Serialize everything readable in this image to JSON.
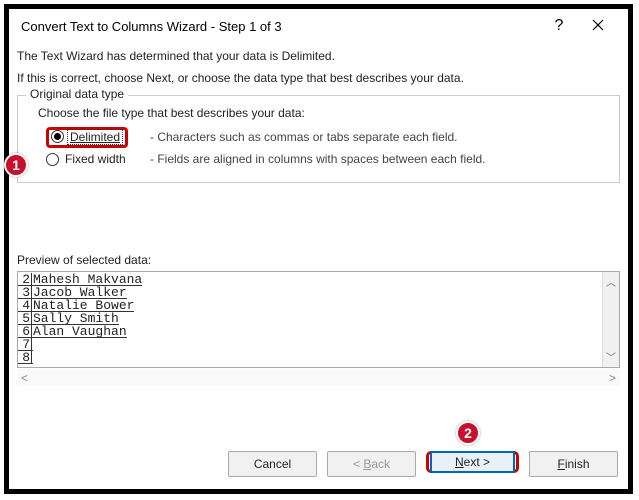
{
  "titlebar": {
    "title": "Convert Text to Columns Wizard - Step 1 of 3",
    "help": "?",
    "close": "✕"
  },
  "intro": {
    "line1": "The Text Wizard has determined that your data is Delimited.",
    "line2": "If this is correct, choose Next, or choose the data type that best describes your data."
  },
  "fieldset": {
    "legend": "Original data type",
    "choose": "Choose the file type that best describes your data:",
    "options": {
      "delimited": {
        "label": "Delimited",
        "desc": "- Characters such as commas or tabs separate each field."
      },
      "fixed": {
        "label": "Fixed width",
        "desc": "- Fields are aligned in columns with spaces between each field."
      }
    }
  },
  "preview": {
    "label": "Preview of selected data:",
    "rows": [
      {
        "n": "2",
        "v": "Mahesh Makvana"
      },
      {
        "n": "3",
        "v": "Jacob Walker"
      },
      {
        "n": "4",
        "v": "Natalie Bower"
      },
      {
        "n": "5",
        "v": "Sally Smith"
      },
      {
        "n": "6",
        "v": "Alan Vaughan"
      },
      {
        "n": "7",
        "v": ""
      },
      {
        "n": "8",
        "v": ""
      }
    ]
  },
  "buttons": {
    "cancel": "Cancel",
    "back": "< Back",
    "next": "Next >",
    "finish": "Finish"
  },
  "callouts": {
    "c1": "1",
    "c2": "2"
  }
}
